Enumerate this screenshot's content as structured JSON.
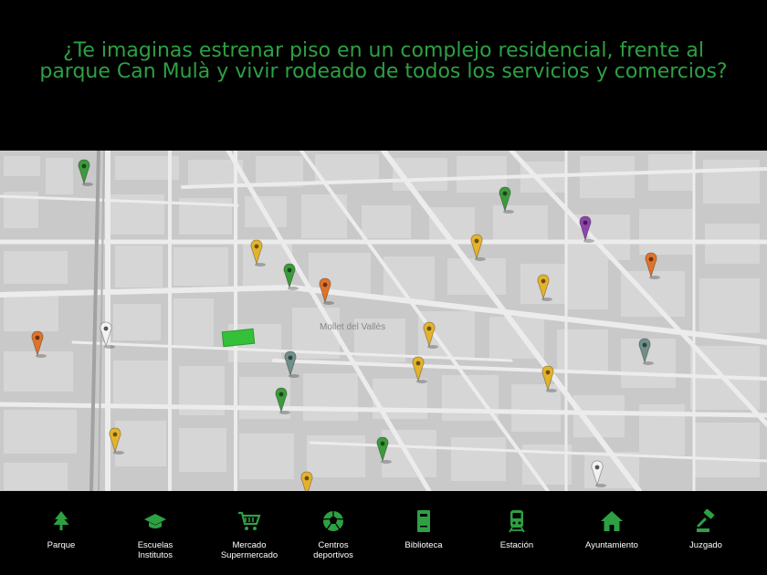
{
  "header": {
    "headline": "¿Te imaginas estrenar piso en un complejo residencial, frente al parque Can Mulà y vivir rodeado de todos los servicios y comercios?"
  },
  "map": {
    "place_label": "Mollet del Vallès",
    "colors": {
      "background": "#c8c8c8",
      "block": "#d9d9d9",
      "street": "#ebebeb",
      "rail": "#9a9a9a",
      "highlight": "#35c03a",
      "green": "#3c9a3c",
      "yellow": "#e5b32b",
      "orange": "#e0732a",
      "purple": "#8e44ad",
      "teal": "#6f8f8a",
      "white": "#f2f2f2"
    },
    "markers": [
      {
        "category": "parque",
        "icon": "tree-icon"
      },
      {
        "category": "parque",
        "icon": "tree-icon"
      },
      {
        "category": "parque",
        "icon": "tree-icon"
      },
      {
        "category": "parque",
        "icon": "tree-icon"
      },
      {
        "category": "parque",
        "icon": "tree-icon"
      },
      {
        "category": "mercado",
        "icon": "cart-icon"
      },
      {
        "category": "mercado",
        "icon": "cart-icon"
      },
      {
        "category": "mercado",
        "icon": "cart-icon"
      },
      {
        "category": "mercado",
        "icon": "cart-icon"
      },
      {
        "category": "mercado",
        "icon": "cart-icon"
      },
      {
        "category": "mercado",
        "icon": "cart-icon"
      },
      {
        "category": "mercado",
        "icon": "cart-icon"
      },
      {
        "category": "mercado",
        "icon": "cart-icon"
      },
      {
        "category": "mercado",
        "icon": "cart-icon"
      },
      {
        "category": "ayuntamiento",
        "icon": "house-icon"
      },
      {
        "category": "ayuntamiento",
        "icon": "house-icon"
      },
      {
        "category": "ayuntamiento",
        "icon": "house-icon"
      },
      {
        "category": "juzgado",
        "icon": "gavel-icon"
      },
      {
        "category": "centros-deportivos",
        "icon": "ball-icon"
      },
      {
        "category": "centros-deportivos",
        "icon": "ball-icon"
      },
      {
        "category": "estacion",
        "icon": "train-icon"
      },
      {
        "category": "estacion",
        "icon": "train-icon"
      }
    ]
  },
  "legend": {
    "items": [
      {
        "label": "Parque",
        "icon": "tree-icon"
      },
      {
        "label": "Escuelas\nInstitutos",
        "icon": "graduation-cap-icon"
      },
      {
        "label": "Mercado\nSupermercado",
        "icon": "shopping-cart-icon"
      },
      {
        "label": "Centros\ndeportivos",
        "icon": "soccer-ball-icon"
      },
      {
        "label": "Biblioteca",
        "icon": "book-icon"
      },
      {
        "label": "Estación",
        "icon": "train-icon"
      },
      {
        "label": "Ayuntamiento",
        "icon": "house-icon"
      },
      {
        "label": "Juzgado",
        "icon": "gavel-icon"
      }
    ],
    "icon_color": "#2ea043"
  }
}
